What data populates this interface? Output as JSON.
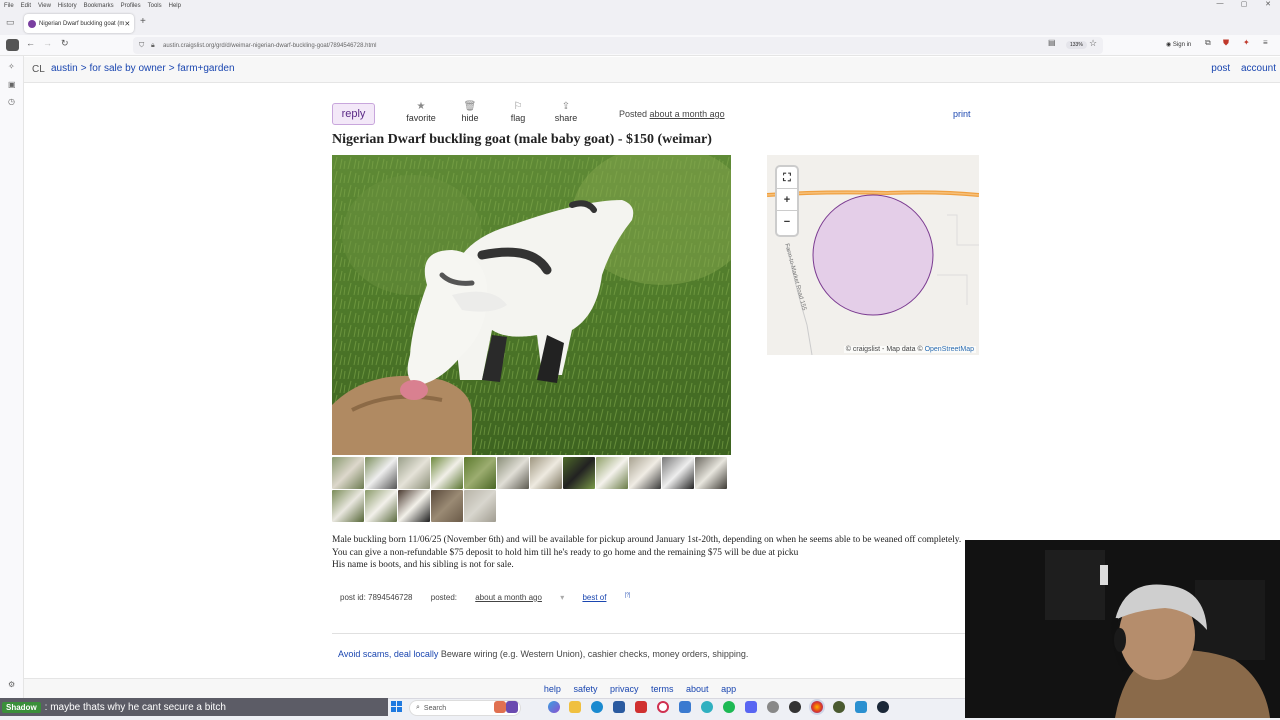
{
  "browser": {
    "menu": [
      "File",
      "Edit",
      "View",
      "History",
      "Bookmarks",
      "Profiles",
      "Tools",
      "Help"
    ],
    "tab_title": "Nigerian Dwarf buckling goat (m",
    "url": "austin.craigslist.org/grd/d/weimar-nigerian-dwarf-buckling-goat/7894546728.html",
    "zoom": "133%",
    "sign_in": "Sign in"
  },
  "header": {
    "logo": "CL",
    "crumbs": [
      "austin",
      "for sale by owner",
      "farm+garden"
    ],
    "post": "post",
    "account": "account"
  },
  "actions": {
    "reply": "reply",
    "favorite": "favorite",
    "hide": "hide",
    "flag": "flag",
    "share": "share",
    "posted_label": "Posted",
    "posted_time": "about a month ago",
    "print": "print"
  },
  "listing": {
    "title": "Nigerian Dwarf buckling goat (male baby goat) - $150 (weimar)",
    "description": "Male buckling born 11/06/25 (November 6th) and will be available for pickup around January 1st-20th, depending on when he seems able to be weaned off completely. You can give a non-refundable $75 deposit to hold him till he's ready to go home and the remaining $75 will be due at picku",
    "description_2": "His name is boots, and his sibling is not for sale.",
    "post_id_label": "post id: 7894546728",
    "posted_label": "posted:",
    "posted_time": "about a month ago",
    "best_of": "best of",
    "best_of_sup": "[?]"
  },
  "map": {
    "road_label": "Farm-to-Market Road 155",
    "attribution": "© craigslist - Map data ©",
    "attribution_link": "OpenStreetMap",
    "controls": [
      "⛶",
      "+",
      "−"
    ]
  },
  "notice": {
    "link": "Avoid scams, deal locally",
    "text": "Beware wiring (e.g. Western Union), cashier checks, money orders, shipping."
  },
  "footer": {
    "links": [
      "help",
      "safety",
      "privacy",
      "terms",
      "about",
      "app"
    ]
  },
  "taskbar": {
    "chat_name": "Shadow",
    "chat_text": ": maybe thats why he cant secure a bitch",
    "search_placeholder": "Search"
  }
}
